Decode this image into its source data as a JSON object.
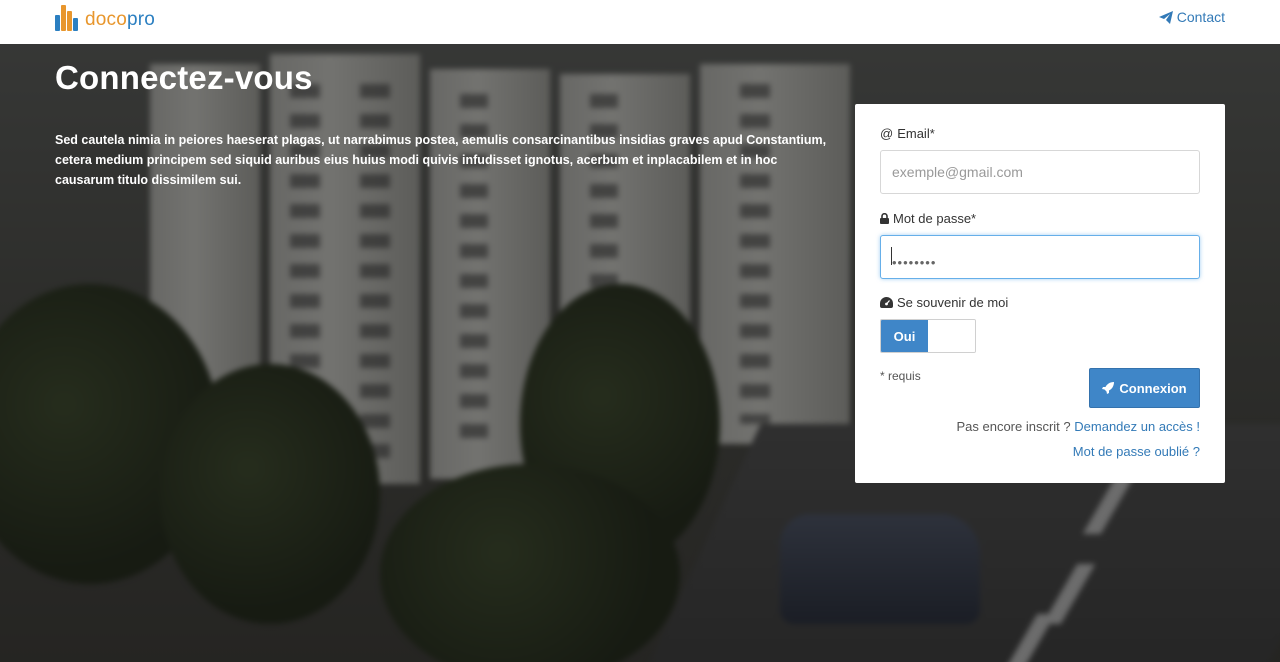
{
  "navbar": {
    "brand_part1": "doco",
    "brand_part2": "pro",
    "contact_label": "Contact",
    "logo_colors": [
      "#e8962c",
      "#2b7fc1",
      "#e8962c",
      "#2b7fc1"
    ]
  },
  "hero": {
    "title": "Connectez-vous",
    "description": "Sed cautela nimia in peiores haeserat plagas, ut narrabimus postea, aemulis consarcinantibus insidias graves apud Constantium, cetera medium principem sed siquid auribus eius huius modi quivis infudisset ignotus, acerbum et inplacabilem et in hoc causarum titulo dissimilem sui."
  },
  "login_form": {
    "email_label": "Email*",
    "email_icon": "at-icon",
    "email_placeholder": "exemple@gmail.com",
    "email_value": "",
    "password_label": "Mot de passe*",
    "password_icon": "lock-icon",
    "password_value": "••••••••",
    "remember_label": "Se souvenir de moi",
    "remember_icon": "dashboard-icon",
    "remember_toggle_on_label": "Oui",
    "required_note": "* requis",
    "submit_label": "Connexion",
    "submit_icon": "rocket-icon",
    "signup_prompt": "Pas encore inscrit ?",
    "signup_link": "Demandez un accès !",
    "forgot_link": "Mot de passe oublié ?"
  },
  "colors": {
    "primary": "#3f86c8",
    "link": "#337ab7",
    "brand_orange": "#e8962c",
    "brand_blue": "#2b7fc1"
  }
}
